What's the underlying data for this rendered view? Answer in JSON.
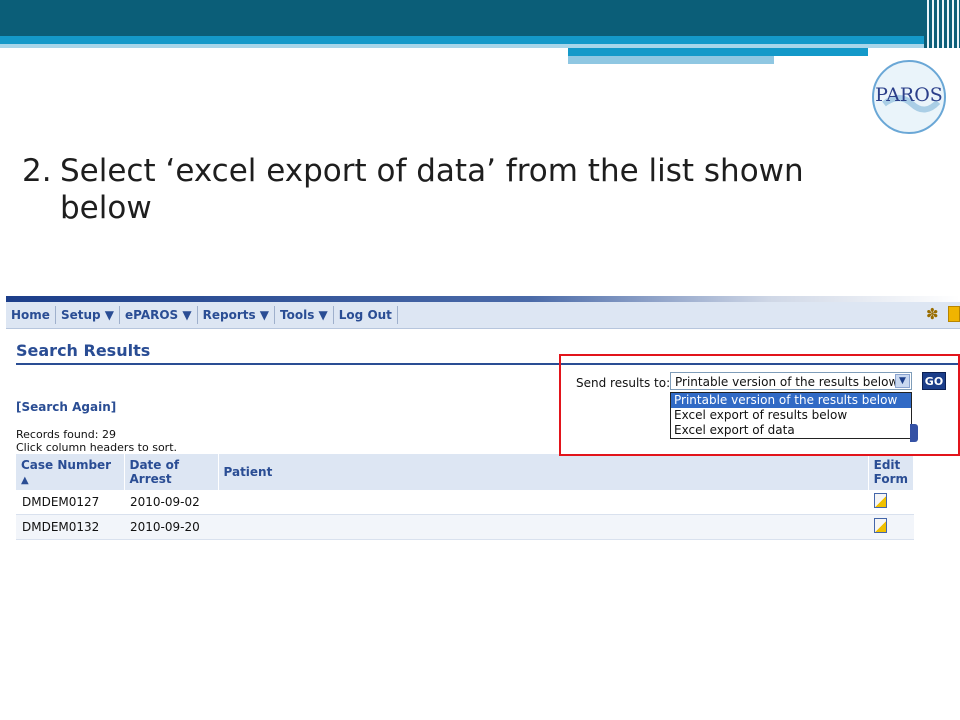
{
  "slide": {
    "step_number": "2.",
    "instruction_line1": "Select ‘excel export of data’ from the list shown",
    "instruction_line2": "below",
    "logo_text": "PAROS"
  },
  "nav": {
    "items": [
      "Home",
      "Setup ▼",
      "ePAROS ▼",
      "Reports ▼",
      "Tools ▼",
      "Log Out"
    ]
  },
  "page": {
    "title": "Search Results",
    "search_again": "[Search Again]",
    "records_found": "Records found: 29",
    "sort_hint": "Click column headers to sort."
  },
  "send_results": {
    "label": "Send results to:",
    "selected": "Printable version of the results below",
    "options": [
      "Printable version of the results below",
      "Excel export of results below",
      "Excel export of data"
    ],
    "go_label": "GO"
  },
  "table": {
    "headers": [
      "Case Number",
      "Date of Arrest",
      "Patient",
      "Edit Form"
    ],
    "sort_indicator": "▲",
    "rows": [
      {
        "case": "DMDEM0127",
        "date": "2010-09-02",
        "patient": ""
      },
      {
        "case": "DMDEM0132",
        "date": "2010-09-20",
        "patient": ""
      }
    ]
  },
  "colors": {
    "header_dark": "#0b5e78",
    "header_accent": "#1499c9",
    "app_blue": "#2a4d94",
    "highlight_red": "#e2141b",
    "selection_blue": "#316ac5"
  },
  "icons": [
    "paros-logo-icon",
    "gear-icon",
    "mail-icon",
    "sort-asc-icon",
    "edit-form-icon",
    "dropdown-arrow-icon"
  ]
}
